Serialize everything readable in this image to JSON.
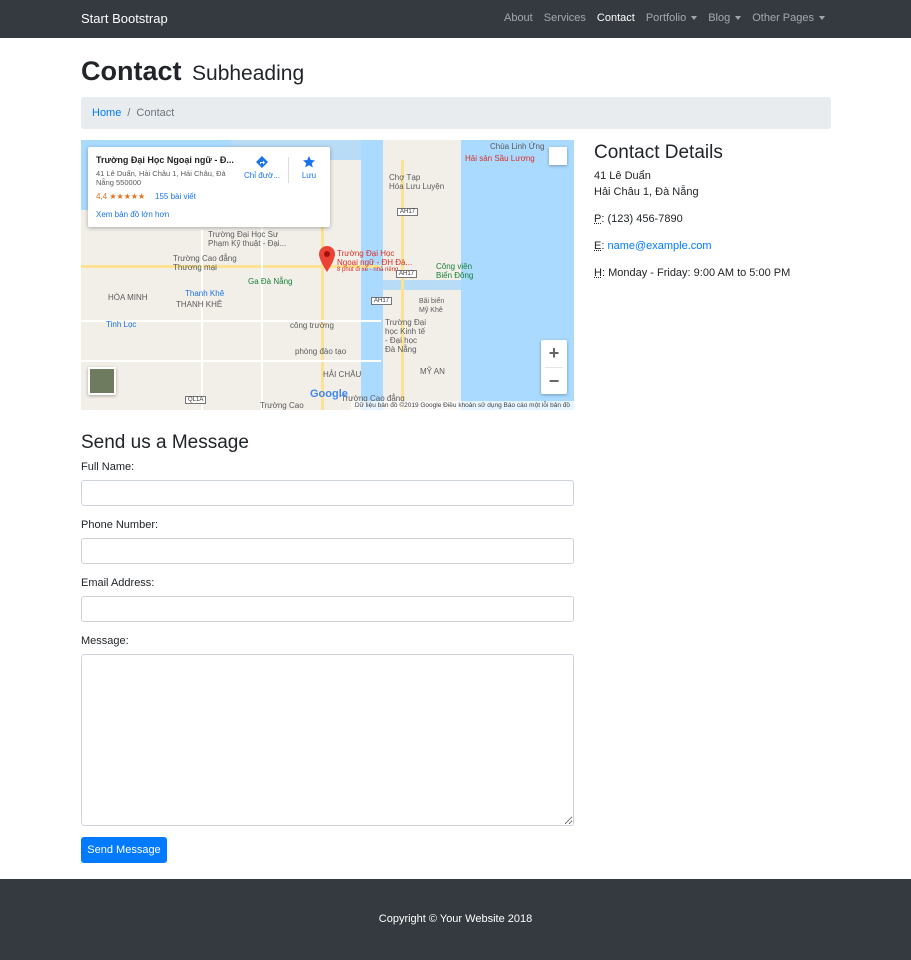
{
  "navbar": {
    "brand": "Start Bootstrap",
    "items": [
      {
        "label": "About"
      },
      {
        "label": "Services"
      },
      {
        "label": "Contact"
      },
      {
        "label": "Portfolio"
      },
      {
        "label": "Blog"
      },
      {
        "label": "Other Pages"
      }
    ]
  },
  "page": {
    "title": "Contact",
    "subtitle": "Subheading"
  },
  "breadcrumb": {
    "home": "Home",
    "separator": "/",
    "current": "Contact"
  },
  "map": {
    "card": {
      "title": "Trường Đại Học Ngoại ngữ - Đ...",
      "address": "41 Lê Duẩn, Hải Châu 1, Hải Châu, Đà Nẵng 550000",
      "rating": "4,4 ★★★★★",
      "reviews": "155 bài viết",
      "view_larger": "Xem bản đồ lớn hơn",
      "directions": "Chỉ đườ...",
      "save": "Lưu"
    },
    "labels": {
      "chua_linh_ung": "Chùa Linh Ứng",
      "hai_san": "Hải sản Sầu Lương",
      "cho_hoa_lac": "Chợ Tạp\nHóa Lưu Luyện",
      "truong_su_pham": "Trường Đại Học Sư\nPhạm Kỹ thuật - Đại...",
      "truong_cao_dang": "Trường Cao đẳng\nThương mại",
      "marker_label": "Trường Đại Học\nNgoại ngữ - ĐH Đà...",
      "marker_sub": "8 phút đi xe - nhà riêng",
      "cong_vien": "Công viên\nBiển Đông",
      "ga_da_nang": "Ga Đà Nẵng",
      "hoa_minh": "HÒA MINH",
      "thanh_khe_blue": "Thanh Khê",
      "thanh_khe": "THANH KHÊ",
      "tinh_loc": "Tinh Lọc",
      "cong_truong": "công trường",
      "bai_bien": "Bãi biển\nMỹ Khê",
      "truong_kinh_te": "Trường Đại\nhọc Kinh tế\n- Đại học\nĐà Nẵng",
      "phong_dao_tao": "phòng đào tạo",
      "hai_chau": "HẢI CHÂU",
      "my_an": "MỸ AN",
      "truong_cao_dang_2": "Trường Cao đẳng",
      "truong_cao_2": "Trường Cao",
      "hwy1": "AH17",
      "hwy2": "AH17",
      "hwy3": "AH17",
      "ql1a": "QL1A"
    },
    "google": "Google",
    "footer": "Dữ liệu bản đồ ©2019 Google    Điều khoản sử dụng    Báo cáo một lỗi bản đồ",
    "zoom_in": "+",
    "zoom_out": "−"
  },
  "contact_details": {
    "title": "Contact Details",
    "address_line1": "41 Lê Duẩn",
    "address_line2": "Hải Châu 1, Đà Nẵng",
    "phone_abbr": "P",
    "phone": "(123) 456-7890",
    "email_abbr": "E",
    "email": "name@example.com",
    "hours_abbr": "H",
    "hours": "Monday - Friday: 9:00 AM to 5:00 PM"
  },
  "form": {
    "title": "Send us a Message",
    "full_name_label": "Full Name:",
    "full_name_value": "",
    "phone_label": "Phone Number:",
    "phone_value": "",
    "email_label": "Email Address:",
    "email_value": "",
    "message_label": "Message:",
    "message_value": "",
    "submit_label": "Send Message"
  },
  "footer": {
    "copyright": "Copyright © Your Website 2018"
  },
  "colors": {
    "navbar_bg": "#343a40",
    "primary": "#007bff",
    "breadcrumb_bg": "#e9ecef"
  }
}
